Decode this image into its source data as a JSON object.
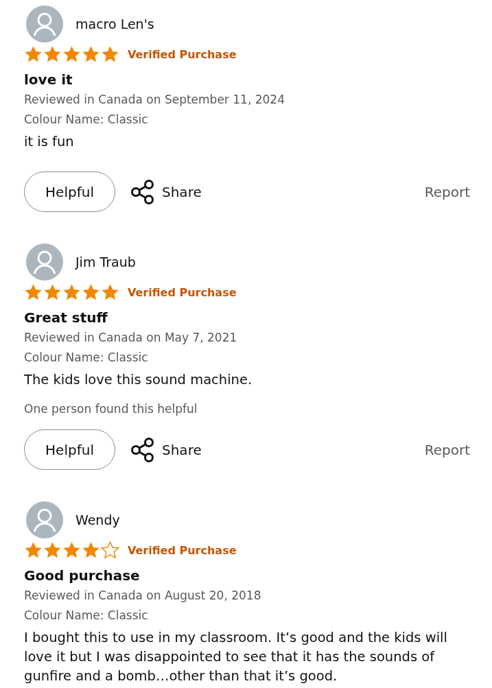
{
  "reviews": [
    {
      "name": "macro Len's",
      "stars": 5,
      "badge": "Verified Purchase",
      "title": "love it",
      "date": "Reviewed in Canada on September 11, 2024",
      "variant": "Colour Name: Classic",
      "body": "it is fun",
      "actions": {
        "helpful": "Helpful",
        "share": "Share",
        "report": "Report"
      }
    },
    {
      "name": "Jim Traub",
      "stars": 5,
      "badge": "Verified Purchase",
      "title": "Great stuff",
      "date": "Reviewed in Canada on May 7, 2021",
      "variant": "Colour Name: Classic",
      "body": "The kids love this sound machine.",
      "helpful_count": "One person found this helpful",
      "actions": {
        "helpful": "Helpful",
        "share": "Share",
        "report": "Report"
      }
    },
    {
      "name": "Wendy",
      "stars": 4,
      "badge": "Verified Purchase",
      "title": "Good purchase",
      "date": "Reviewed in Canada on August 20, 2018",
      "variant": "Colour Name: Classic",
      "body": "I bought this to use in my classroom. It’s good and the kids will love it but I was disappointed to see that it has the sounds of gunfire and a bomb…other than that it’s good."
    }
  ]
}
